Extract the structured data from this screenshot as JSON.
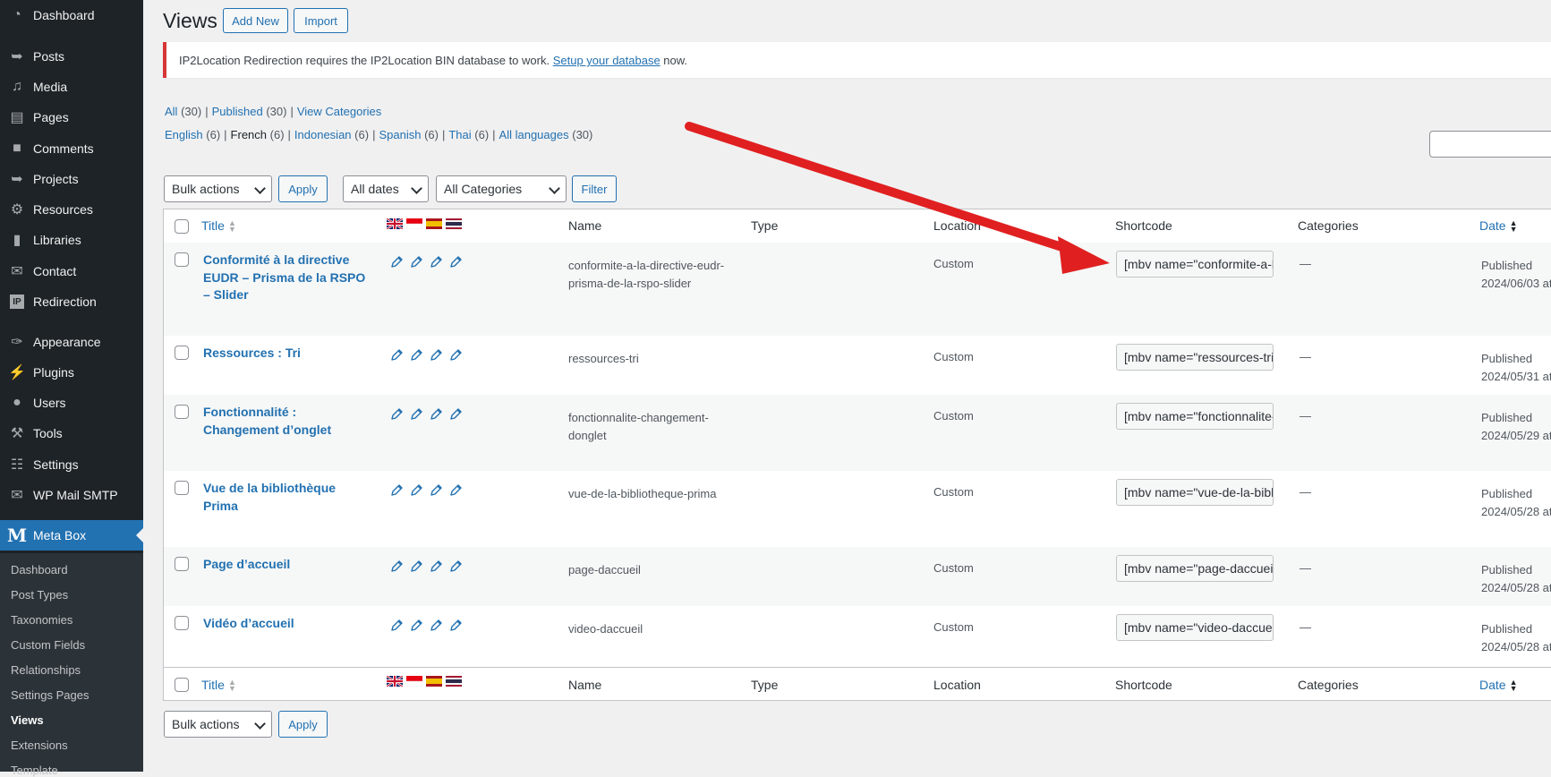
{
  "sidebar": {
    "items": [
      {
        "label": "Dashboard",
        "icon": "dashboard-icon"
      },
      {
        "label": "Posts",
        "icon": "pushpin-icon"
      },
      {
        "label": "Media",
        "icon": "media-icon"
      },
      {
        "label": "Pages",
        "icon": "pages-icon"
      },
      {
        "label": "Comments",
        "icon": "comment-icon"
      },
      {
        "label": "Projects",
        "icon": "pushpin-icon"
      },
      {
        "label": "Resources",
        "icon": "gear-icon"
      },
      {
        "label": "Libraries",
        "icon": "book-icon"
      },
      {
        "label": "Contact",
        "icon": "mail-icon"
      },
      {
        "label": "Redirection",
        "icon": "ip-icon"
      },
      {
        "label": "Appearance",
        "icon": "brush-icon"
      },
      {
        "label": "Plugins",
        "icon": "plugin-icon"
      },
      {
        "label": "Users",
        "icon": "user-icon"
      },
      {
        "label": "Tools",
        "icon": "wrench-icon"
      },
      {
        "label": "Settings",
        "icon": "settings-icon"
      },
      {
        "label": "WP Mail SMTP",
        "icon": "mail-icon"
      },
      {
        "label": "Meta Box",
        "icon": "metabox-logo-icon",
        "logo_letter": "M"
      }
    ],
    "submenu": [
      "Dashboard",
      "Post Types",
      "Taxonomies",
      "Custom Fields",
      "Relationships",
      "Settings Pages",
      "Views",
      "Extensions",
      "Template"
    ]
  },
  "header": {
    "title": "Views",
    "add_new": "Add New",
    "import": "Import"
  },
  "notice": {
    "text_before": "IP2Location Redirection requires the IP2Location BIN database to work. ",
    "link": "Setup your database",
    "text_after": " now."
  },
  "status_filters": {
    "all": "All",
    "all_count": "(30)",
    "published": "Published",
    "published_count": "(30)",
    "categories": "View Categories"
  },
  "language_filters": {
    "english": "English",
    "english_count": "(6)",
    "french": "French",
    "french_count": "(6)",
    "indonesian": "Indonesian",
    "indonesian_count": "(6)",
    "spanish": "Spanish",
    "spanish_count": "(6)",
    "thai": "Thai",
    "thai_count": "(6)",
    "all": "All languages",
    "all_count": "(30)"
  },
  "filters": {
    "bulk_actions": "Bulk actions",
    "apply": "Apply",
    "dates": "All dates",
    "categories": "All Categories",
    "filter": "Filter"
  },
  "columns": {
    "title": "Title",
    "name": "Name",
    "type": "Type",
    "location": "Location",
    "shortcode": "Shortcode",
    "categories": "Categories",
    "date": "Date"
  },
  "flags": [
    "uk-flag-icon",
    "indonesia-flag-icon",
    "spain-flag-icon",
    "thailand-flag-icon"
  ],
  "rows": [
    {
      "title": "Conformité à la directive EUDR – Prisma de la RSPO – Slider",
      "name": "conformite-a-la-directive-eudr-prisma-de-la-rspo-slider",
      "location": "Custom",
      "shortcode": "[mbv name=\"conformite-a-la-directive-eudr-prisma-de-la-rspo-slider\"]",
      "categories": "—",
      "status": "Published",
      "date": "2024/06/03 at"
    },
    {
      "title": "Ressources : Tri",
      "name": "ressources-tri",
      "location": "Custom",
      "shortcode": "[mbv name=\"ressources-tri\"]",
      "categories": "—",
      "status": "Published",
      "date": "2024/05/31 at"
    },
    {
      "title": "Fonctionnalité : Changement d’onglet",
      "name": "fonctionnalite-changement-donglet",
      "location": "Custom",
      "shortcode": "[mbv name=\"fonctionnalite-changement-donglet\"]",
      "categories": "—",
      "status": "Published",
      "date": "2024/05/29 at"
    },
    {
      "title": "Vue de la bibliothèque Prima",
      "name": "vue-de-la-bibliotheque-prima",
      "location": "Custom",
      "shortcode": "[mbv name=\"vue-de-la-bibliotheque-prima\"]",
      "categories": "—",
      "status": "Published",
      "date": "2024/05/28 at"
    },
    {
      "title": "Page d’accueil",
      "name": "page-daccueil",
      "location": "Custom",
      "shortcode": "[mbv name=\"page-daccueil\"]",
      "categories": "—",
      "status": "Published",
      "date": "2024/05/28 at"
    },
    {
      "title": "Vidéo d’accueil",
      "name": "video-daccueil",
      "location": "Custom",
      "shortcode": "[mbv name=\"video-daccueil\"]",
      "categories": "—",
      "status": "Published",
      "date": "2024/05/28 at"
    }
  ],
  "bottom": {
    "bulk_actions": "Bulk actions",
    "apply": "Apply"
  },
  "colors": {
    "sidebar_bg": "#1d2327",
    "accent": "#2271b1",
    "notice_error": "#d63638",
    "arrow": "#e02020"
  }
}
